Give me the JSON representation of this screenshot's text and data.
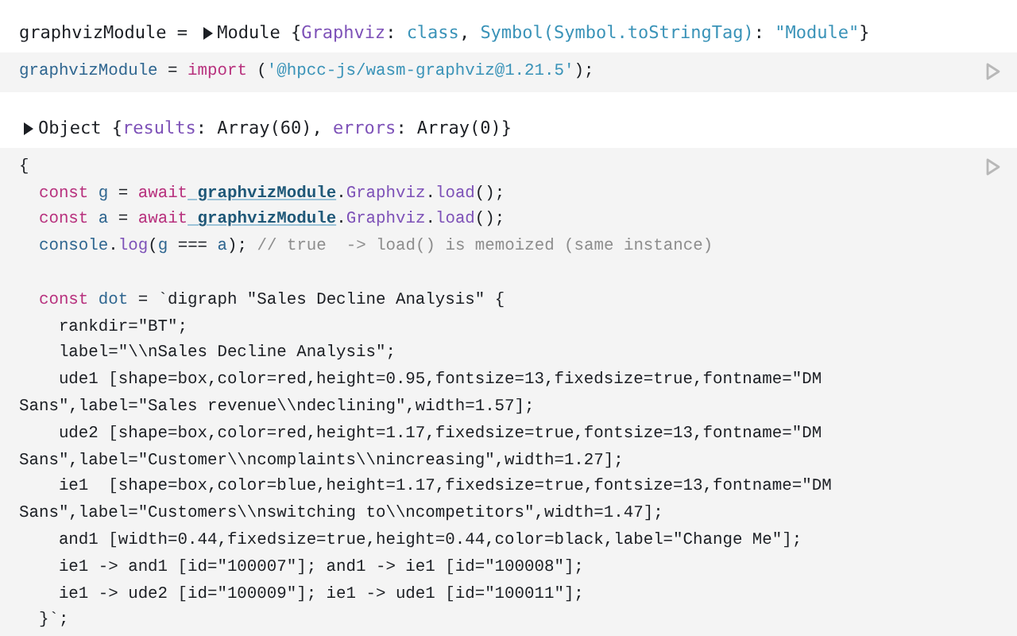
{
  "cells": [
    {
      "output": {
        "expanded": false,
        "segments": [
          {
            "kind": "plain",
            "text": "graphvizModule = "
          },
          {
            "kind": "toggle"
          },
          {
            "kind": "plain",
            "text": "Module {"
          },
          {
            "kind": "property",
            "text": "Graphviz"
          },
          {
            "kind": "plain",
            "text": ": "
          },
          {
            "kind": "string",
            "text": "class"
          },
          {
            "kind": "plain",
            "text": ", "
          },
          {
            "kind": "string",
            "text": "Symbol(Symbol.toStringTag)"
          },
          {
            "kind": "plain",
            "text": ": "
          },
          {
            "kind": "string",
            "text": "\"Module\""
          },
          {
            "kind": "plain",
            "text": "}"
          }
        ]
      },
      "blocks": [
        [
          [
            {
              "kind": "variable",
              "text": "graphvizModule"
            },
            {
              "kind": "plain",
              "text": " = "
            },
            {
              "kind": "keyword",
              "text": "import"
            },
            {
              "kind": "plain",
              "text": " ("
            },
            {
              "kind": "string",
              "text": "'@hpcc-js/wasm-graphviz@1.21.5'"
            },
            {
              "kind": "plain",
              "text": ");"
            }
          ]
        ]
      ]
    },
    {
      "output": {
        "expanded": false,
        "segments": [
          {
            "kind": "toggle"
          },
          {
            "kind": "plain",
            "text": "Object {"
          },
          {
            "kind": "property",
            "text": "results"
          },
          {
            "kind": "plain",
            "text": ": Array(60), "
          },
          {
            "kind": "property",
            "text": "errors"
          },
          {
            "kind": "plain",
            "text": ": Array(0)}"
          }
        ]
      },
      "blocks": [
        [
          [
            {
              "kind": "plain",
              "text": "{"
            }
          ],
          [
            {
              "kind": "keyword",
              "text": "  const"
            },
            {
              "kind": "variable",
              "text": " g"
            },
            {
              "kind": "plain",
              "text": " = "
            },
            {
              "kind": "keyword",
              "text": "await"
            },
            {
              "kind": "ref",
              "text": " graphvizModule"
            },
            {
              "kind": "plain",
              "text": "."
            },
            {
              "kind": "property",
              "text": "Graphviz"
            },
            {
              "kind": "plain",
              "text": "."
            },
            {
              "kind": "property",
              "text": "load"
            },
            {
              "kind": "plain",
              "text": "();"
            }
          ],
          [
            {
              "kind": "keyword",
              "text": "  const"
            },
            {
              "kind": "variable",
              "text": " a"
            },
            {
              "kind": "plain",
              "text": " = "
            },
            {
              "kind": "keyword",
              "text": "await"
            },
            {
              "kind": "ref",
              "text": " graphvizModule"
            },
            {
              "kind": "plain",
              "text": "."
            },
            {
              "kind": "property",
              "text": "Graphviz"
            },
            {
              "kind": "plain",
              "text": "."
            },
            {
              "kind": "property",
              "text": "load"
            },
            {
              "kind": "plain",
              "text": "();"
            }
          ],
          [
            {
              "kind": "variable",
              "text": "  console"
            },
            {
              "kind": "plain",
              "text": "."
            },
            {
              "kind": "property",
              "text": "log"
            },
            {
              "kind": "plain",
              "text": "("
            },
            {
              "kind": "variable",
              "text": "g"
            },
            {
              "kind": "plain",
              "text": " === "
            },
            {
              "kind": "variable",
              "text": "a"
            },
            {
              "kind": "plain",
              "text": "); "
            },
            {
              "kind": "comment",
              "text": "// true  -> load() is memoized (same instance)"
            }
          ]
        ],
        [
          [
            {
              "kind": "keyword",
              "text": "  const"
            },
            {
              "kind": "variable",
              "text": " dot"
            },
            {
              "kind": "plain",
              "text": " = `digraph \"Sales Decline Analysis\" {"
            }
          ],
          [
            {
              "kind": "plain",
              "text": "    rankdir=\"BT\";"
            }
          ],
          [
            {
              "kind": "plain",
              "text": "    label=\"\\\\nSales Decline Analysis\";"
            }
          ],
          [
            {
              "kind": "plain",
              "text": "    ude1 [shape=box,color=red,height=0.95,fontsize=13,fixedsize=true,fontname=\"DM"
            }
          ],
          [
            {
              "kind": "plain",
              "text": "Sans\",label=\"Sales revenue\\\\ndeclining\",width=1.57];"
            }
          ],
          [
            {
              "kind": "plain",
              "text": "    ude2 [shape=box,color=red,height=1.17,fixedsize=true,fontsize=13,fontname=\"DM"
            }
          ],
          [
            {
              "kind": "plain",
              "text": "Sans\",label=\"Customer\\\\ncomplaints\\\\nincreasing\",width=1.27];"
            }
          ],
          [
            {
              "kind": "plain",
              "text": "    ie1  [shape=box,color=blue,height=1.17,fixedsize=true,fontsize=13,fontname=\"DM"
            }
          ],
          [
            {
              "kind": "plain",
              "text": "Sans\",label=\"Customers\\\\nswitching to\\\\ncompetitors\",width=1.47];"
            }
          ],
          [
            {
              "kind": "plain",
              "text": "    and1 [width=0.44,fixedsize=true,height=0.44,color=black,label=\"Change Me\"];"
            }
          ],
          [
            {
              "kind": "plain",
              "text": "    ie1 -> and1 [id=\"100007\"]; and1 -> ie1 [id=\"100008\"];"
            }
          ],
          [
            {
              "kind": "plain",
              "text": "    ie1 -> ude2 [id=\"100009\"]; ie1 -> ude1 [id=\"100011\"];"
            }
          ],
          [
            {
              "kind": "plain",
              "text": "  }`;"
            }
          ]
        ]
      ]
    }
  ]
}
